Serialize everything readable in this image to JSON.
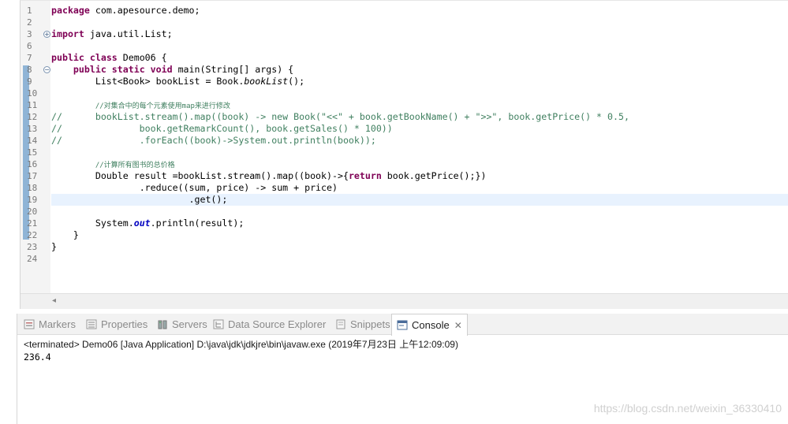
{
  "editor": {
    "line_numbers": [
      "1",
      "2",
      "3",
      "6",
      "7",
      "8",
      "9",
      "10",
      "11",
      "12",
      "13",
      "14",
      "15",
      "16",
      "17",
      "18",
      "19",
      "20",
      "21",
      "22",
      "23",
      "24"
    ],
    "fold_markers": {
      "line3": "+",
      "line8": "−"
    },
    "lines": {
      "l1": {
        "kw1": "package",
        "rest": " com.apesource.demo;"
      },
      "l3": {
        "kw1": "import",
        "rest": " java.util.List;"
      },
      "l7": {
        "kw1": "public",
        "kw2": "class",
        "rest": " Demo06 {"
      },
      "l8": {
        "kw1": "public",
        "kw2": "static",
        "kw3": "void",
        "rest": " main(String[] args) {"
      },
      "l9": {
        "a": "List<Book> bookList = Book.",
        "b": "bookList",
        "c": "();"
      },
      "l11": {
        "comment": "//对集合中的每个元素使用map来进行修改"
      },
      "l12": {
        "a": "//      bookList.stream().map((book) -> new Book(",
        "s1": "\"<<\"",
        "b": " + book.getBookName() + ",
        "s2": "\">>\"",
        "c": ", book.getPrice() * 0.5,"
      },
      "l13": {
        "comment": "//              book.getRemarkCount(), book.getSales() * 100))"
      },
      "l14": {
        "comment": "//              .forEach((book)->System.out.println(book));"
      },
      "l16": {
        "comment": "//计算所有图书的总价格"
      },
      "l17": {
        "a": "Double result =bookList.stream().map((book)->{",
        "kw1": "return",
        "b": " book.getPrice();})"
      },
      "l18": {
        "a": ".reduce((sum, price) -> sum + price)"
      },
      "l19": {
        "a": ".get();"
      },
      "l21": {
        "a": "System.",
        "b": "out",
        "c": ".println(result);"
      },
      "l22": {
        "a": "}"
      },
      "l23": {
        "a": "}"
      }
    }
  },
  "panel": {
    "tabs": [
      {
        "label": "Markers",
        "icon": "markers-icon"
      },
      {
        "label": "Properties",
        "icon": "properties-icon"
      },
      {
        "label": "Servers",
        "icon": "servers-icon"
      },
      {
        "label": "Data Source Explorer",
        "icon": "data-source-icon"
      },
      {
        "label": "Snippets",
        "icon": "snippets-icon"
      },
      {
        "label": "Console",
        "icon": "console-icon",
        "active": true,
        "close": "✕"
      }
    ],
    "status": "<terminated> Demo06 [Java Application] D:\\java\\jdk\\jdkjre\\bin\\javaw.exe (2019年7月23日 上午12:09:09)",
    "output": "236.4"
  },
  "watermark": "https://blog.csdn.net/weixin_36330410",
  "colors": {
    "keyword": "#7f0055",
    "comment": "#3f7f5f",
    "string": "#2a00ff",
    "static_field": "#0000c0",
    "current_line": "#e8f2fe"
  }
}
